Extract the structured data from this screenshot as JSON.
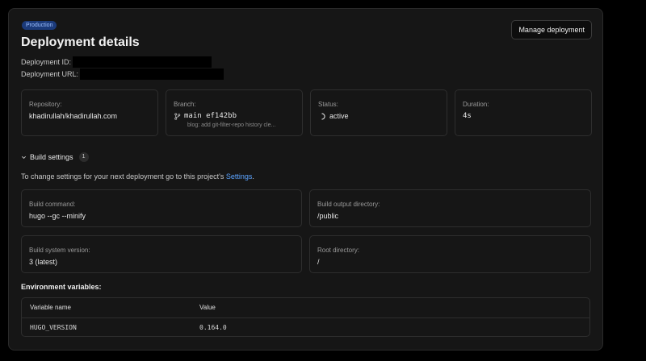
{
  "header": {
    "env_badge": "Production",
    "title": "Deployment details",
    "deployment_id_label": "Deployment ID:",
    "deployment_url_label": "Deployment URL:",
    "manage_button": "Manage deployment"
  },
  "summary": {
    "repository": {
      "label": "Repository:",
      "value": "khadirullah/khadirullah.com"
    },
    "branch": {
      "label": "Branch:",
      "branch_icon": "git-branch-icon",
      "value": "main ef142bb",
      "commit_message": "blog: add git-filter-repo history cle..."
    },
    "status": {
      "label": "Status:",
      "status_icon": "spinner-icon",
      "value": "active"
    },
    "duration": {
      "label": "Duration:",
      "value": "4s"
    }
  },
  "build_settings": {
    "toggle_label": "Build settings",
    "count": "1",
    "note_prefix": "To change settings for your next deployment go to this project's",
    "note_link": "Settings",
    "note_suffix": ".",
    "build_command": {
      "label": "Build command:",
      "value": "hugo --gc --minify"
    },
    "output_directory": {
      "label": "Build output directory:",
      "value": "/public"
    },
    "system_version": {
      "label": "Build system version:",
      "value": "3 (latest)"
    },
    "root_directory": {
      "label": "Root directory:",
      "value": "/"
    }
  },
  "environment": {
    "title": "Environment variables:",
    "columns": [
      "Variable name",
      "Value"
    ],
    "rows": [
      {
        "name": "HUGO_VERSION",
        "value": "0.164.0"
      }
    ]
  },
  "colors": {
    "background": "#000000",
    "panel": "#161616",
    "border": "#2e2e2e",
    "link": "#5ba3ff",
    "badge_bg": "#1b3a7a",
    "badge_text": "#9ec0ff"
  }
}
